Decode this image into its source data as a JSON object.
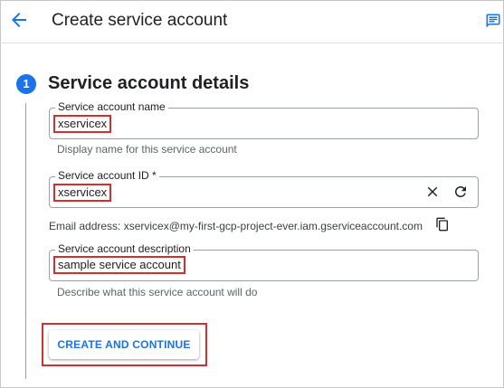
{
  "header": {
    "title": "Create service account",
    "back_icon": "arrow-back-icon",
    "feedback_icon": "feedback-icon"
  },
  "step": {
    "number": "1",
    "title": "Service account details"
  },
  "fields": {
    "name": {
      "label": "Service account name",
      "value": "xservicex",
      "hint": "Display name for this service account"
    },
    "id": {
      "label": "Service account ID *",
      "value": "xservicex",
      "clear_icon": "close-icon",
      "refresh_icon": "refresh-icon"
    },
    "email": {
      "text": "Email address: xservicex@my-first-gcp-project-ever.iam.gserviceaccount.com",
      "copy_icon": "copy-icon"
    },
    "description": {
      "label": "Service account description",
      "value": "sample service account",
      "hint": "Describe what this service account will do"
    }
  },
  "actions": {
    "create_label": "CREATE AND CONTINUE"
  },
  "colors": {
    "accent": "#1a73e8",
    "highlight": "#d32f2f"
  }
}
